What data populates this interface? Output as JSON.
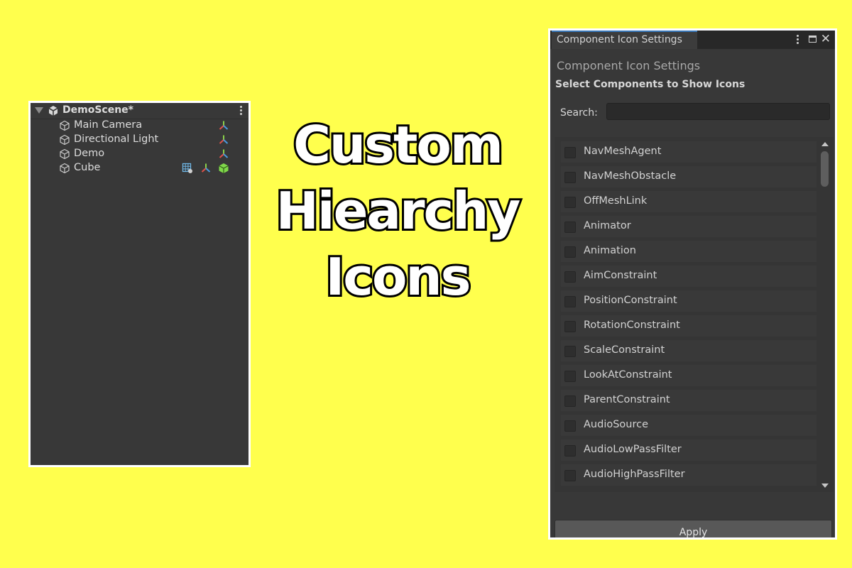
{
  "hierarchy": {
    "scene_name": "DemoScene*",
    "objects": [
      {
        "label": "Main Camera",
        "components": [
          "transform-icon"
        ]
      },
      {
        "label": "Directional Light",
        "components": [
          "transform-icon"
        ]
      },
      {
        "label": "Demo",
        "components": [
          "transform-icon"
        ]
      },
      {
        "label": "Cube",
        "components": [
          "mesh-filter-icon",
          "transform-icon",
          "box-collider-icon"
        ]
      }
    ]
  },
  "title": {
    "line1": "Custom",
    "line2": "Hiearchy",
    "line3": "Icons"
  },
  "window": {
    "tab_title": "Component Icon Settings",
    "heading": "Component Icon Settings",
    "subheading": "Select Components to Show Icons",
    "search_label": "Search:",
    "search_value": "",
    "items": [
      {
        "label": "NavMeshAgent",
        "checked": false
      },
      {
        "label": "NavMeshObstacle",
        "checked": false
      },
      {
        "label": "OffMeshLink",
        "checked": false
      },
      {
        "label": "Animator",
        "checked": false
      },
      {
        "label": "Animation",
        "checked": false
      },
      {
        "label": "AimConstraint",
        "checked": false
      },
      {
        "label": "PositionConstraint",
        "checked": false
      },
      {
        "label": "RotationConstraint",
        "checked": false
      },
      {
        "label": "ScaleConstraint",
        "checked": false
      },
      {
        "label": "LookAtConstraint",
        "checked": false
      },
      {
        "label": "ParentConstraint",
        "checked": false
      },
      {
        "label": "AudioSource",
        "checked": false
      },
      {
        "label": "AudioLowPassFilter",
        "checked": false
      },
      {
        "label": "AudioHighPassFilter",
        "checked": false
      }
    ],
    "apply_label": "Apply"
  },
  "colors": {
    "background": "#ffff4d",
    "panel": "#383838",
    "tab_accent": "#3a79bb",
    "transform_red": "#e0524a",
    "transform_green": "#8ad14a",
    "transform_blue": "#4a9be0",
    "collider_green": "#7fd84a"
  }
}
